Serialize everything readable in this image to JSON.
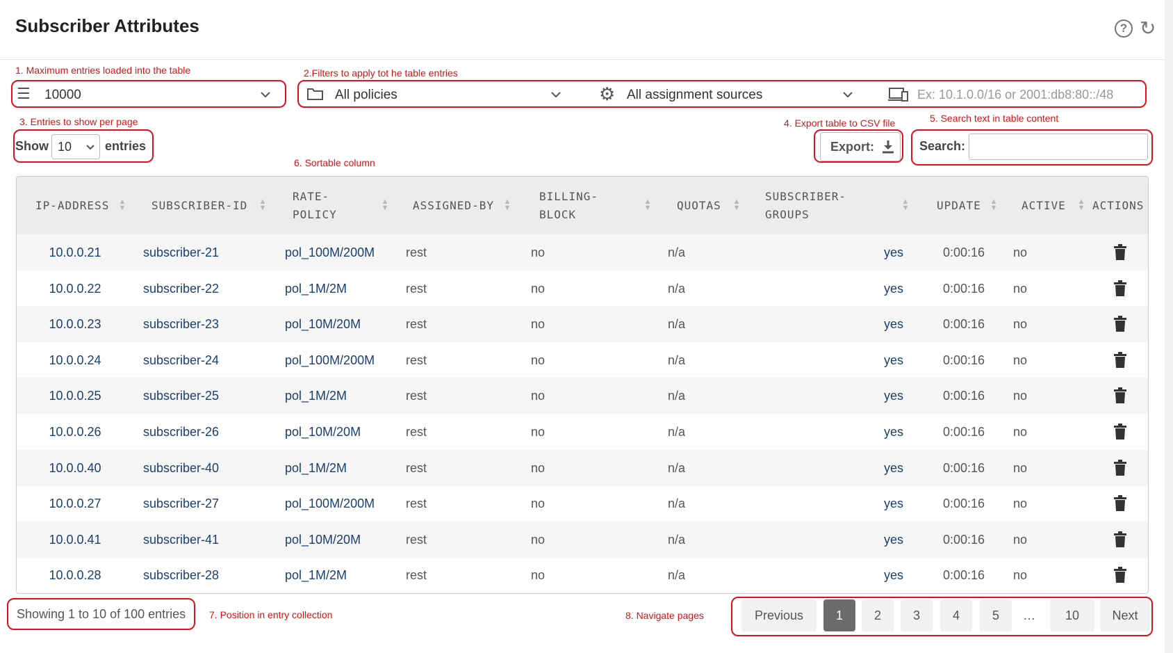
{
  "page": {
    "title": "Subscriber Attributes"
  },
  "annotations": {
    "a1": "1. Maximum entries loaded into the table",
    "a2": "2.Filters to apply tot he table entries",
    "a3": "3. Entries to show per page",
    "a4": "4. Export table to CSV file",
    "a5": "5. Search text in table content",
    "a6": "6. Sortable column",
    "a7": "7. Position in entry collection",
    "a8": "8. Navigate pages"
  },
  "controls": {
    "max_entries": "10000",
    "policy_filter": "All policies",
    "source_filter": "All assignment sources",
    "ip_filter_placeholder": "Ex: 10.1.0.0/16 or 2001:db8:80::/48",
    "show_label": "Show",
    "show_value": "10",
    "entries_label": "entries",
    "export_label": "Export:",
    "search_label": "Search:"
  },
  "table": {
    "columns": {
      "ip": "IP-ADDRESS",
      "sub": "SUBSCRIBER-ID",
      "rate1": "RATE-",
      "rate2": "POLICY",
      "assigned": "ASSIGNED-BY",
      "billing1": "BILLING-",
      "billing2": "BLOCK",
      "quotas": "QUOTAS",
      "groups1": "SUBSCRIBER-",
      "groups2": "GROUPS",
      "update": "UPDATE",
      "active": "ACTIVE",
      "actions": "ACTIONS"
    },
    "rows": [
      {
        "ip": "10.0.0.21",
        "sub": "subscriber-21",
        "policy": "pol_100M/200M",
        "assigned": "rest",
        "billing": "no",
        "quotas": "n/a",
        "groups": "yes",
        "update": "0:00:16",
        "active": "no"
      },
      {
        "ip": "10.0.0.22",
        "sub": "subscriber-22",
        "policy": "pol_1M/2M",
        "assigned": "rest",
        "billing": "no",
        "quotas": "n/a",
        "groups": "yes",
        "update": "0:00:16",
        "active": "no"
      },
      {
        "ip": "10.0.0.23",
        "sub": "subscriber-23",
        "policy": "pol_10M/20M",
        "assigned": "rest",
        "billing": "no",
        "quotas": "n/a",
        "groups": "yes",
        "update": "0:00:16",
        "active": "no"
      },
      {
        "ip": "10.0.0.24",
        "sub": "subscriber-24",
        "policy": "pol_100M/200M",
        "assigned": "rest",
        "billing": "no",
        "quotas": "n/a",
        "groups": "yes",
        "update": "0:00:16",
        "active": "no"
      },
      {
        "ip": "10.0.0.25",
        "sub": "subscriber-25",
        "policy": "pol_1M/2M",
        "assigned": "rest",
        "billing": "no",
        "quotas": "n/a",
        "groups": "yes",
        "update": "0:00:16",
        "active": "no"
      },
      {
        "ip": "10.0.0.26",
        "sub": "subscriber-26",
        "policy": "pol_10M/20M",
        "assigned": "rest",
        "billing": "no",
        "quotas": "n/a",
        "groups": "yes",
        "update": "0:00:16",
        "active": "no"
      },
      {
        "ip": "10.0.0.40",
        "sub": "subscriber-40",
        "policy": "pol_1M/2M",
        "assigned": "rest",
        "billing": "no",
        "quotas": "n/a",
        "groups": "yes",
        "update": "0:00:16",
        "active": "no"
      },
      {
        "ip": "10.0.0.27",
        "sub": "subscriber-27",
        "policy": "pol_100M/200M",
        "assigned": "rest",
        "billing": "no",
        "quotas": "n/a",
        "groups": "yes",
        "update": "0:00:16",
        "active": "no"
      },
      {
        "ip": "10.0.0.41",
        "sub": "subscriber-41",
        "policy": "pol_10M/20M",
        "assigned": "rest",
        "billing": "no",
        "quotas": "n/a",
        "groups": "yes",
        "update": "0:00:16",
        "active": "no"
      },
      {
        "ip": "10.0.0.28",
        "sub": "subscriber-28",
        "policy": "pol_1M/2M",
        "assigned": "rest",
        "billing": "no",
        "quotas": "n/a",
        "groups": "yes",
        "update": "0:00:16",
        "active": "no"
      }
    ]
  },
  "footer": {
    "info": "Showing 1 to 10 of 100 entries",
    "pagination": {
      "previous": "Previous",
      "pages": [
        "1",
        "2",
        "3",
        "4",
        "5"
      ],
      "ellipsis": "…",
      "last": "10",
      "next": "Next",
      "active": "1"
    }
  },
  "colors": {
    "annotation": "#e01010",
    "link": "#1b3f6e",
    "active_page": "#6b6b6b"
  }
}
